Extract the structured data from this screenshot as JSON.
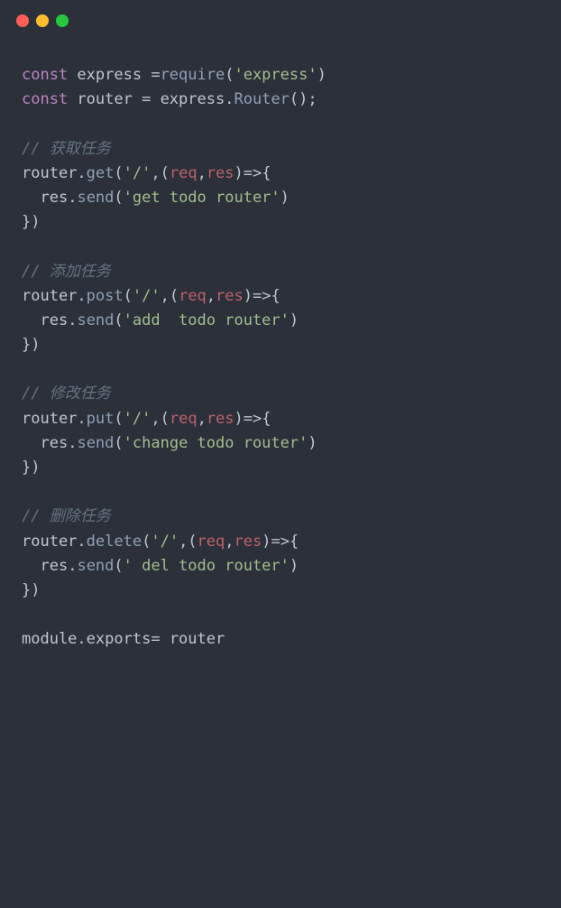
{
  "code": {
    "l1_const1": "const",
    "l1_express": " express ",
    "l1_eq": "=",
    "l1_require": "require",
    "l1_paren1": "(",
    "l1_str": "'express'",
    "l1_paren2": ")",
    "l2_const": "const",
    "l2_router": " router ",
    "l2_eq": "= ",
    "l2_express": "express",
    "l2_dot": ".",
    "l2_Router": "Router",
    "l2_parens": "();",
    "c1": "// 获取任务",
    "r1_router": "router",
    "r1_dot": ".",
    "r1_get": "get",
    "r1_open": "(",
    "r1_path": "'/'",
    "r1_comma": ",(",
    "r1_req": "req",
    "r1_c2": ",",
    "r1_res": "res",
    "r1_arrow": ")=>{",
    "r1_body_indent": "  ",
    "r1_body_res": "res",
    "r1_body_dot": ".",
    "r1_body_send": "send",
    "r1_body_open": "(",
    "r1_body_str": "'get todo router'",
    "r1_body_close": ")",
    "r1_close": "})",
    "c2": "// 添加任务",
    "r2_router": "router",
    "r2_dot": ".",
    "r2_post": "post",
    "r2_open": "(",
    "r2_path": "'/'",
    "r2_comma": ",(",
    "r2_req": "req",
    "r2_c2": ",",
    "r2_res": "res",
    "r2_arrow": ")=>{",
    "r2_body_indent": "  ",
    "r2_body_res": "res",
    "r2_body_dot": ".",
    "r2_body_send": "send",
    "r2_body_open": "(",
    "r2_body_str": "'add  todo router'",
    "r2_body_close": ")",
    "r2_close": "})",
    "c3": "// 修改任务",
    "r3_router": "router",
    "r3_dot": ".",
    "r3_put": "put",
    "r3_open": "(",
    "r3_path": "'/'",
    "r3_comma": ",(",
    "r3_req": "req",
    "r3_c2": ",",
    "r3_res": "res",
    "r3_arrow": ")=>{",
    "r3_body_indent": "  ",
    "r3_body_res": "res",
    "r3_body_dot": ".",
    "r3_body_send": "send",
    "r3_body_open": "(",
    "r3_body_str": "'change todo router'",
    "r3_body_close": ")",
    "r3_close": "})",
    "c4": "// 删除任务",
    "r4_router": "router",
    "r4_dot": ".",
    "r4_delete": "delete",
    "r4_open": "(",
    "r4_path": "'/'",
    "r4_comma": ",(",
    "r4_req": "req",
    "r4_c2": ",",
    "r4_res": "res",
    "r4_arrow": ")=>{",
    "r4_body_indent": "  ",
    "r4_body_res": "res",
    "r4_body_dot": ".",
    "r4_body_send": "send",
    "r4_body_open": "(",
    "r4_body_str": "' del todo router'",
    "r4_body_close": ")",
    "r4_close": "})",
    "exp_module": "module",
    "exp_dot": ".",
    "exp_exports": "exports",
    "exp_eq": "= ",
    "exp_router": "router"
  }
}
